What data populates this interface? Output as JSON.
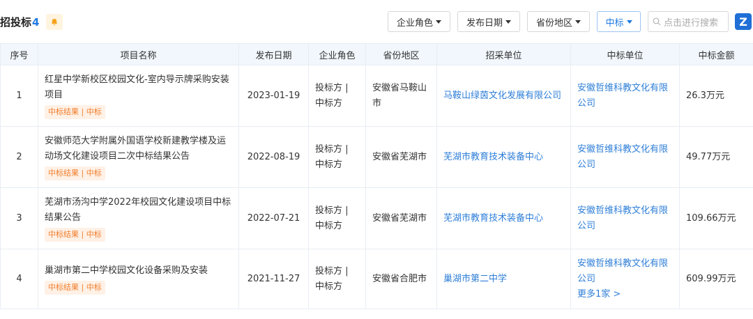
{
  "header": {
    "title": "招投标",
    "count": "4",
    "filters": [
      {
        "label": "企业角色"
      },
      {
        "label": "发布日期"
      },
      {
        "label": "省份地区"
      },
      {
        "label": "中标"
      }
    ],
    "search_placeholder": "点击进行搜索",
    "logo_letter": "Z"
  },
  "table": {
    "columns": [
      "序号",
      "项目名称",
      "发布日期",
      "企业角色",
      "省份地区",
      "招采单位",
      "中标单位",
      "中标金额"
    ],
    "rows": [
      {
        "index": "1",
        "name": "红星中学新校区校园文化-室内导示牌采购安装项目",
        "tag": "中标结果 | 中标",
        "date": "2023-01-19",
        "role": "投标方 | 中标方",
        "region": "安徽省马鞍山市",
        "buyer": "马鞍山绿茵文化发展有限公司",
        "winner": "安徽哲维科教文化有限公司",
        "amount": "26.3万元"
      },
      {
        "index": "2",
        "name": "安徽师范大学附属外国语学校新建教学楼及运动场文化建设项目二次中标结果公告",
        "tag": "中标结果 | 中标",
        "date": "2022-08-19",
        "role": "投标方 | 中标方",
        "region": "安徽省芜湖市",
        "buyer": "芜湖市教育技术装备中心",
        "winner": "安徽哲维科教文化有限公司",
        "amount": "49.77万元"
      },
      {
        "index": "3",
        "name": "芜湖市汤沟中学2022年校园文化建设项目中标结果公告",
        "tag": "中标结果 | 中标",
        "date": "2022-07-21",
        "role": "投标方 | 中标方",
        "region": "安徽省芜湖市",
        "buyer": "芜湖市教育技术装备中心",
        "winner": "安徽哲维科教文化有限公司",
        "amount": "109.66万元"
      },
      {
        "index": "4",
        "name": "巢湖市第二中学校园文化设备采购及安装",
        "tag": "中标结果 | 中标",
        "date": "2021-11-27",
        "role": "投标方 | 中标方",
        "region": "安徽省合肥市",
        "buyer": "巢湖市第二中学",
        "winner": "安徽哲维科教文化有限公司",
        "winner_more": "更多1家 >",
        "amount": "609.99万元"
      }
    ]
  },
  "colors": {
    "accent": "#1f7ae0",
    "link": "#2f7fd8",
    "tag_text": "#f07d2b",
    "tag_bg": "#fff1e6",
    "header_bg": "#f2f7fd"
  },
  "icons": {
    "bell": "bell-icon",
    "search": "search-icon",
    "logo": "z-logo"
  }
}
